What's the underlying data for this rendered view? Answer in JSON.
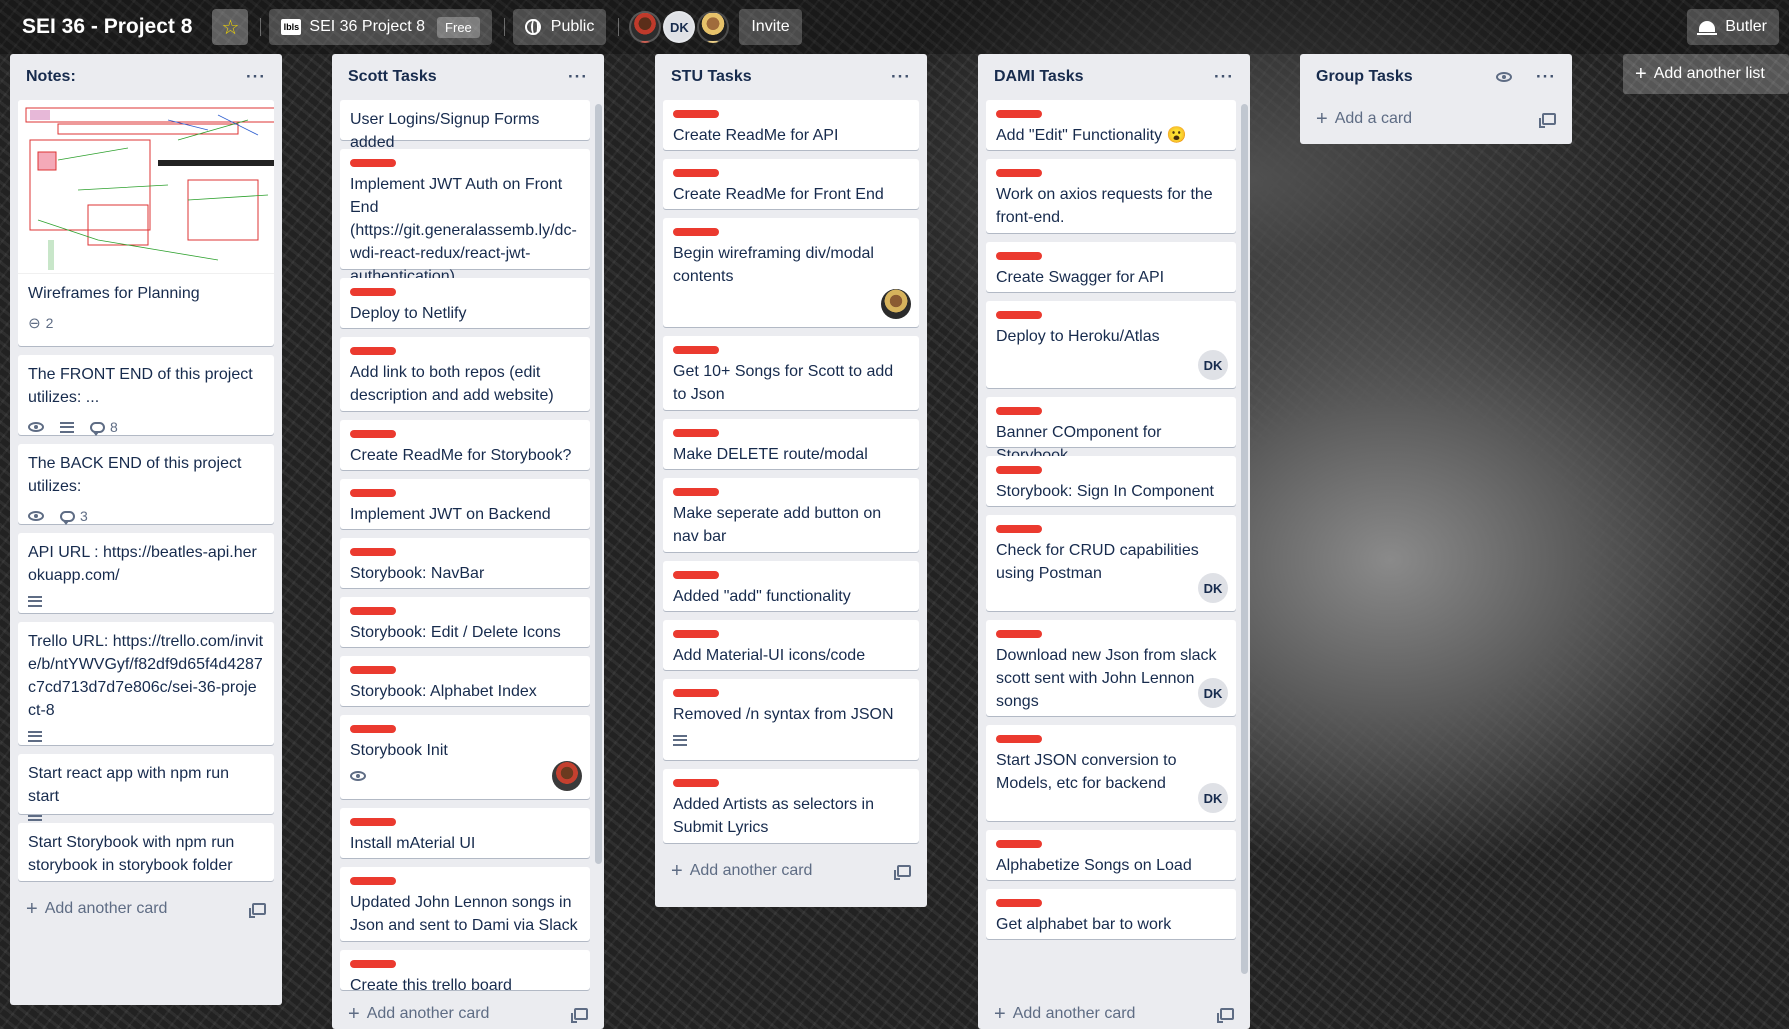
{
  "header": {
    "board_title": "SEI 36 - Project 8",
    "team_logo_text": "lbls",
    "team_name": "SEI 36 Project 8",
    "team_plan": "Free",
    "visibility": "Public",
    "member_initials": "DK",
    "invite_label": "Invite",
    "butler_label": "Butler"
  },
  "lists": [
    {
      "title": "Notes:",
      "add_card_label": "Add another card",
      "cards": [
        {
          "text": "Wireframes for Planning",
          "attachments": "2"
        },
        {
          "text": "The FRONT END of this project utilizes: ...",
          "comments": "8"
        },
        {
          "text": "The BACK END of this project utilizes:",
          "comments": "3"
        },
        {
          "text": "API URL : https://beatles-api.herokuapp.com/"
        },
        {
          "text": "Trello URL: https://trello.com/invite/b/ntYWVGyf/f82df9d65f4d4287c7cd713d7d7e806c/sei-36-project-8"
        },
        {
          "text": "Start react app with npm run start"
        },
        {
          "text": "Start Storybook with npm run storybook in storybook folder"
        }
      ]
    },
    {
      "title": "Scott Tasks",
      "add_card_label": "Add another card",
      "cards": [
        {
          "text": "User Logins/Signup Forms added"
        },
        {
          "text": "Implement JWT Auth on Front End (https://git.generalassemb.ly/dc-wdi-react-redux/react-jwt-authentication)"
        },
        {
          "text": "Deploy to Netlify"
        },
        {
          "text": "Add link to both repos (edit description and add website)"
        },
        {
          "text": "Create ReadMe for Storybook?"
        },
        {
          "text": "Implement JWT on Backend"
        },
        {
          "text": "Storybook: NavBar"
        },
        {
          "text": "Storybook: Edit / Delete Icons"
        },
        {
          "text": "Storybook: Alphabet Index"
        },
        {
          "text": "Storybook Init"
        },
        {
          "text": "Install mAterial UI"
        },
        {
          "text": "Updated John Lennon songs in Json and sent to Dami via Slack"
        },
        {
          "text": "Create this trello board"
        }
      ]
    },
    {
      "title": "STU Tasks",
      "add_card_label": "Add another card",
      "cards": [
        {
          "text": "Create ReadMe for API"
        },
        {
          "text": "Create ReadMe for Front End"
        },
        {
          "text": "Begin wireframing div/modal contents"
        },
        {
          "text": "Get 10+ Songs for Scott to add to Json"
        },
        {
          "text": "Make DELETE route/modal"
        },
        {
          "text": "Make seperate add button on nav bar"
        },
        {
          "text": "Added \"add\" functionality"
        },
        {
          "text": "Add Material-UI icons/code"
        },
        {
          "text": "Removed /n syntax from JSON"
        },
        {
          "text": "Added Artists as selectors in Submit Lyrics"
        }
      ]
    },
    {
      "title": "DAMI Tasks",
      "add_card_label": "Add another card",
      "cards": [
        {
          "text": "Add \"Edit\" Functionality 😮"
        },
        {
          "text": "Work on axios requests for the front-end."
        },
        {
          "text": "Create Swagger for API"
        },
        {
          "text": "Deploy to Heroku/Atlas",
          "member": "DK"
        },
        {
          "text": "Banner COmponent for Storybook"
        },
        {
          "text": "Storybook: Sign In Component"
        },
        {
          "text": "Check for CRUD capabilities using Postman",
          "member": "DK"
        },
        {
          "text": "Download new Json from slack scott sent with John Lennon songs",
          "member": "DK"
        },
        {
          "text": "Start JSON conversion to Models, etc for backend",
          "member": "DK"
        },
        {
          "text": "Alphabetize Songs on Load"
        },
        {
          "text": "Get alphabet bar to work"
        }
      ]
    },
    {
      "title": "Group Tasks",
      "add_card_label": "Add a card",
      "cards": []
    }
  ],
  "add_list_label": "Add another list",
  "colors": {
    "label_red": "#eb3a2f",
    "list_bg": "#ebecf0",
    "star": "#f2d600"
  }
}
